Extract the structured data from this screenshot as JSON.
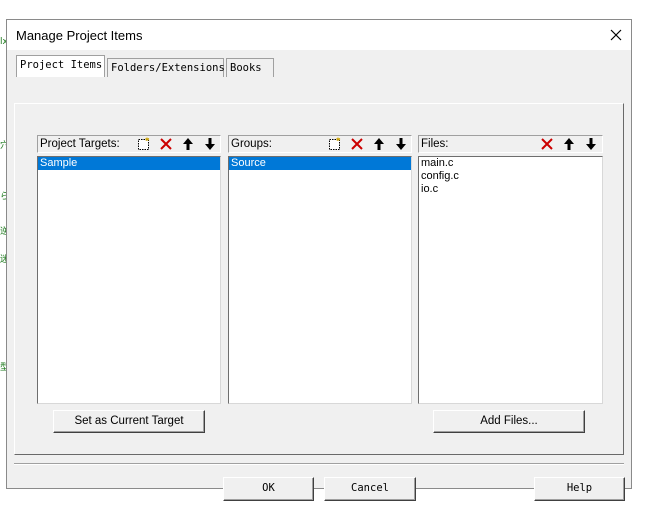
{
  "dialog": {
    "title": "Manage Project Items",
    "close_icon": "close-icon"
  },
  "tabs": [
    {
      "label": "Project Items",
      "active": true
    },
    {
      "label": "Folders/Extensions",
      "active": false
    },
    {
      "label": "Books",
      "active": false
    }
  ],
  "targets": {
    "header": "Project Targets:",
    "items": [
      {
        "label": "Sample",
        "selected": true
      }
    ],
    "button_label": "Set as Current Target"
  },
  "groups": {
    "header": "Groups:",
    "items": [
      {
        "label": "Source",
        "selected": true
      }
    ]
  },
  "files": {
    "header": "Files:",
    "items": [
      {
        "label": "main.c",
        "selected": false
      },
      {
        "label": "config.c",
        "selected": false
      },
      {
        "label": "io.c",
        "selected": false
      }
    ],
    "button_label": "Add Files..."
  },
  "footer": {
    "ok_label": "OK",
    "cancel_label": "Cancel",
    "help_label": "Help"
  },
  "background_fragments": [
    "lx",
    "穴",
    "ら",
    "逆",
    "迷",
    "型"
  ],
  "colors": {
    "selection": "#0078d7",
    "delete_icon": "#cc0000"
  }
}
